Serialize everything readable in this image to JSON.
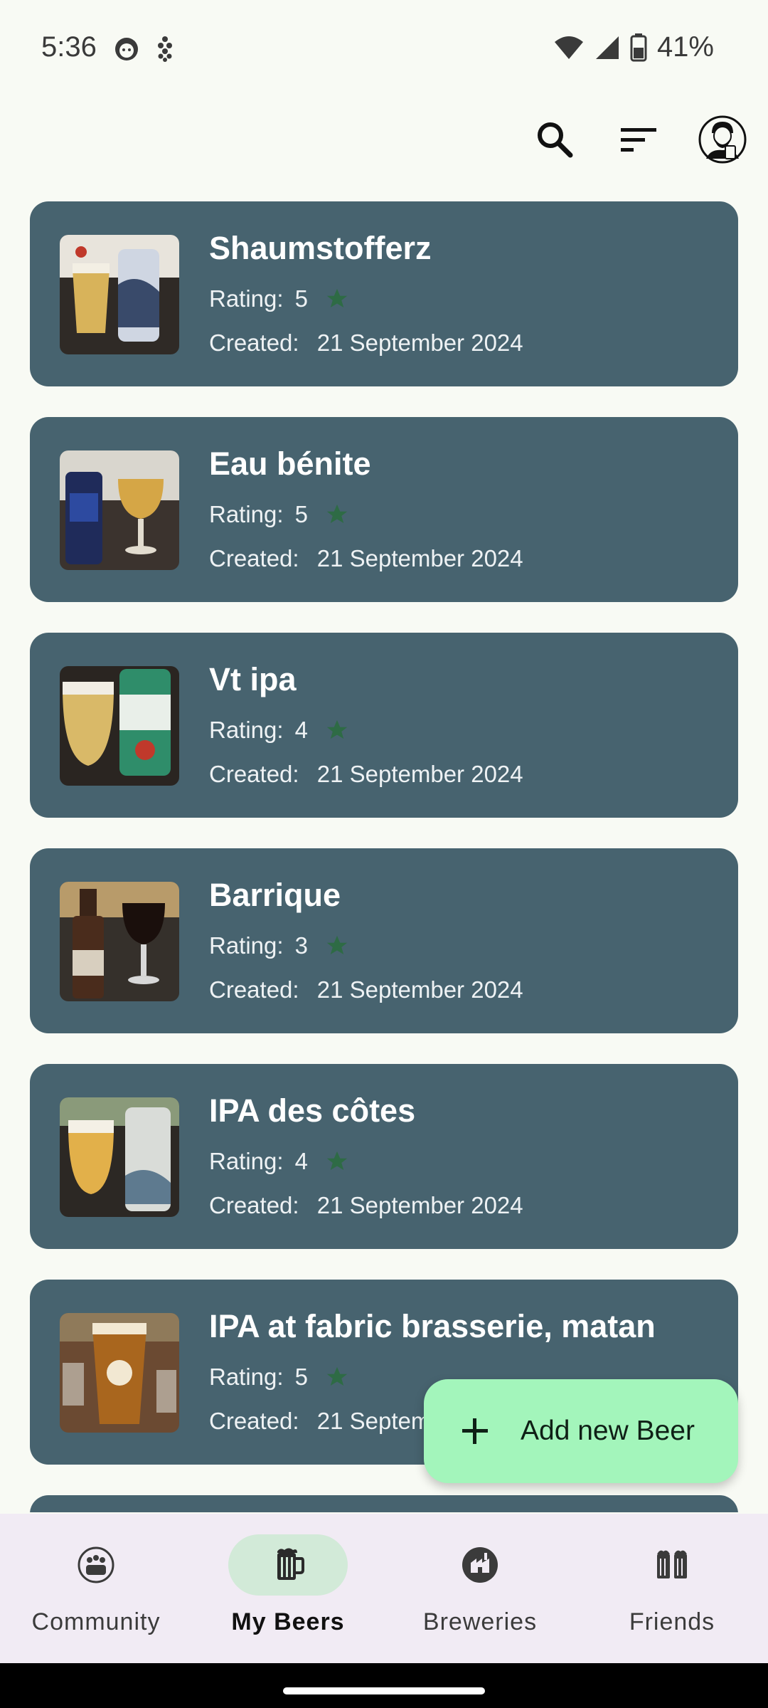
{
  "status_bar": {
    "time": "5:36",
    "battery": "41%"
  },
  "header": {
    "icons": [
      "search-icon",
      "sort-icon",
      "profile-avatar"
    ]
  },
  "labels": {
    "rating": "Rating:",
    "created": "Created:"
  },
  "beers": [
    {
      "name": "Shaumstofferz",
      "rating": "5",
      "created": "21 September 2024"
    },
    {
      "name": "Eau bénite",
      "rating": "5",
      "created": "21 September 2024"
    },
    {
      "name": "Vt ipa",
      "rating": "4",
      "created": "21 September 2024"
    },
    {
      "name": "Barrique",
      "rating": "3",
      "created": "21 September 2024"
    },
    {
      "name": "IPA des côtes",
      "rating": "4",
      "created": "21 September 2024"
    },
    {
      "name": "IPA at fabric brasserie, matan",
      "rating": "5",
      "created": "21 September 2024"
    }
  ],
  "fab": {
    "label": "Add new Beer"
  },
  "bottom_nav": [
    {
      "label": "Community",
      "icon": "community-icon"
    },
    {
      "label": "My Beers",
      "icon": "beer-mug-icon"
    },
    {
      "label": "Breweries",
      "icon": "brewery-icon"
    },
    {
      "label": "Friends",
      "icon": "friends-icon"
    }
  ],
  "colors": {
    "card": "#47636f",
    "star": "#2e6b45",
    "fab": "#a3f5bb",
    "nav_background": "#f1ebf4",
    "nav_active": "#d2ead8"
  }
}
